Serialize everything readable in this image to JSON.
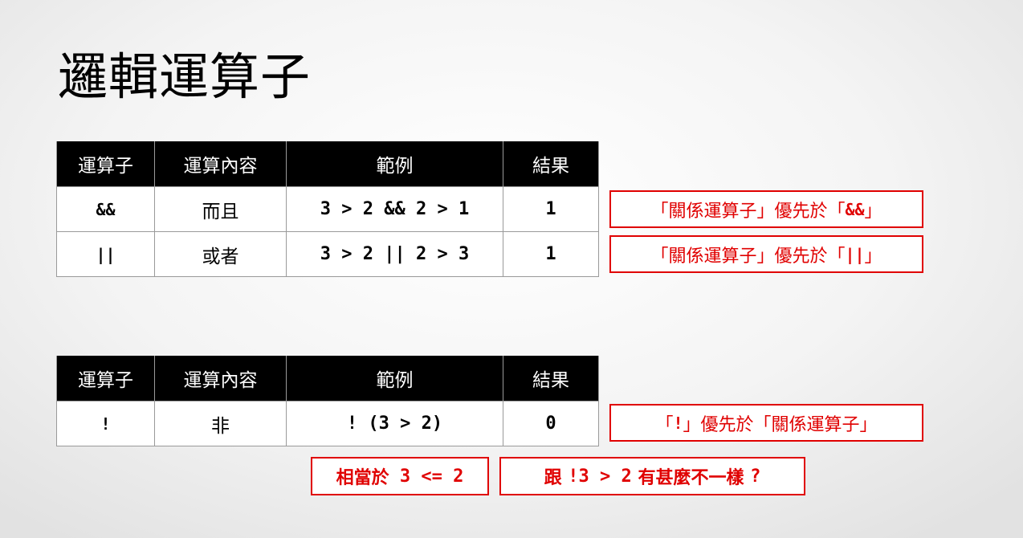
{
  "title": "邏輯運算子",
  "headers": [
    "運算子",
    "運算內容",
    "範例",
    "結果"
  ],
  "binary_table": {
    "rows": [
      {
        "operator": "&&",
        "meaning": "而且",
        "example": "3 > 2 && 2 > 1",
        "result": "1"
      },
      {
        "operator": "||",
        "meaning": "或者",
        "example": "3 > 2 || 2 > 3",
        "result": "1"
      }
    ]
  },
  "unary_table": {
    "rows": [
      {
        "operator": "!",
        "meaning": "非",
        "example": "! (3 > 2)",
        "result": "0"
      }
    ]
  },
  "notes": {
    "and": {
      "prefix": "「關係運算子」優先於「",
      "code": "&&",
      "suffix": "」"
    },
    "or": {
      "prefix": "「關係運算子」優先於「",
      "code": "||",
      "suffix": "」"
    },
    "not": {
      "prefix": "「",
      "code": "!",
      "suffix": "」優先於「關係運算子」"
    },
    "equivalent": {
      "text": "相當於",
      "code": " 3 <= 2"
    },
    "difference": {
      "lead": "跟 ",
      "code": "!3 > 2",
      "tail": " 有甚麼不一樣 ",
      "mark": "?"
    }
  },
  "colors": {
    "accent_red": "#e00000",
    "header_bg": "#000000",
    "header_text": "#ffffff",
    "cell_border": "#9a9a9a"
  }
}
